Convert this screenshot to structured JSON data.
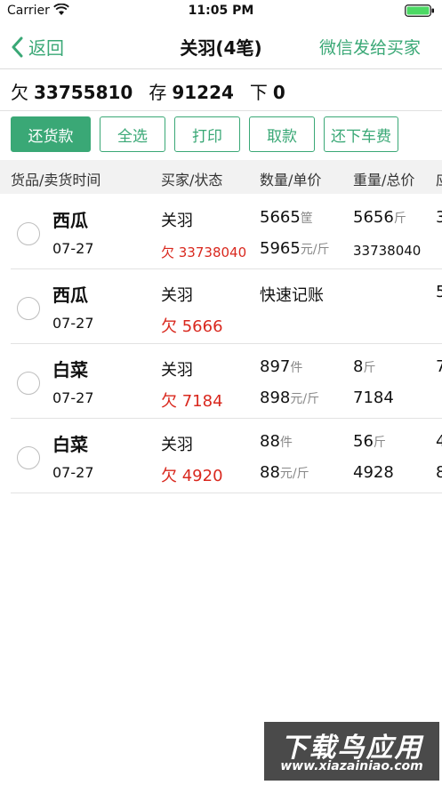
{
  "status_bar": {
    "carrier": "Carrier",
    "time": "11:05 PM"
  },
  "nav": {
    "back_label": "返回",
    "title": "关羽(4笔)",
    "wechat_label": "微信发给买家"
  },
  "summary": {
    "owe_label": "欠",
    "owe_value": "33755810",
    "stock_label": "存",
    "stock_value": "91224",
    "down_label": "下",
    "down_value": "0"
  },
  "actions": [
    "还货款",
    "全选",
    "打印",
    "取款",
    "还下车费"
  ],
  "table": {
    "headers": [
      "货品/卖货时间",
      "买家/状态",
      "数量/单价",
      "重量/总价",
      "应"
    ],
    "rows": [
      {
        "goods": "西瓜",
        "date": "07-27",
        "buyer": "关羽",
        "debt": "欠 33738040",
        "qty": "5665",
        "qty_unit": "筐",
        "price": "5965",
        "price_unit": "元/斤",
        "weight": "5656",
        "weight_unit": "斤",
        "total": "33738040",
        "extra1": "3",
        "extra2": ""
      },
      {
        "goods": "西瓜",
        "date": "07-27",
        "buyer": "关羽",
        "debt": "欠 5666",
        "qty": "快速记账",
        "qty_unit": "",
        "price": "",
        "price_unit": "",
        "weight": "",
        "weight_unit": "",
        "total": "",
        "extra1": "5",
        "extra2": ""
      },
      {
        "goods": "白菜",
        "date": "07-27",
        "buyer": "关羽",
        "debt": "欠 7184",
        "qty": "897",
        "qty_unit": "件",
        "price": "898",
        "price_unit": "元/斤",
        "weight": "8",
        "weight_unit": "斤",
        "total": "7184",
        "extra1": "7",
        "extra2": ""
      },
      {
        "goods": "白菜",
        "date": "07-27",
        "buyer": "关羽",
        "debt": "欠 4920",
        "qty": "88",
        "qty_unit": "件",
        "price": "88",
        "price_unit": "元/斤",
        "weight": "56",
        "weight_unit": "斤",
        "total": "4928",
        "extra1": "4",
        "extra2": "8"
      }
    ]
  },
  "watermark": {
    "title": "下载鸟应用",
    "url": "www.xiazainiao.com"
  },
  "colors": {
    "accent": "#3aa876",
    "debt": "#d9281e"
  }
}
